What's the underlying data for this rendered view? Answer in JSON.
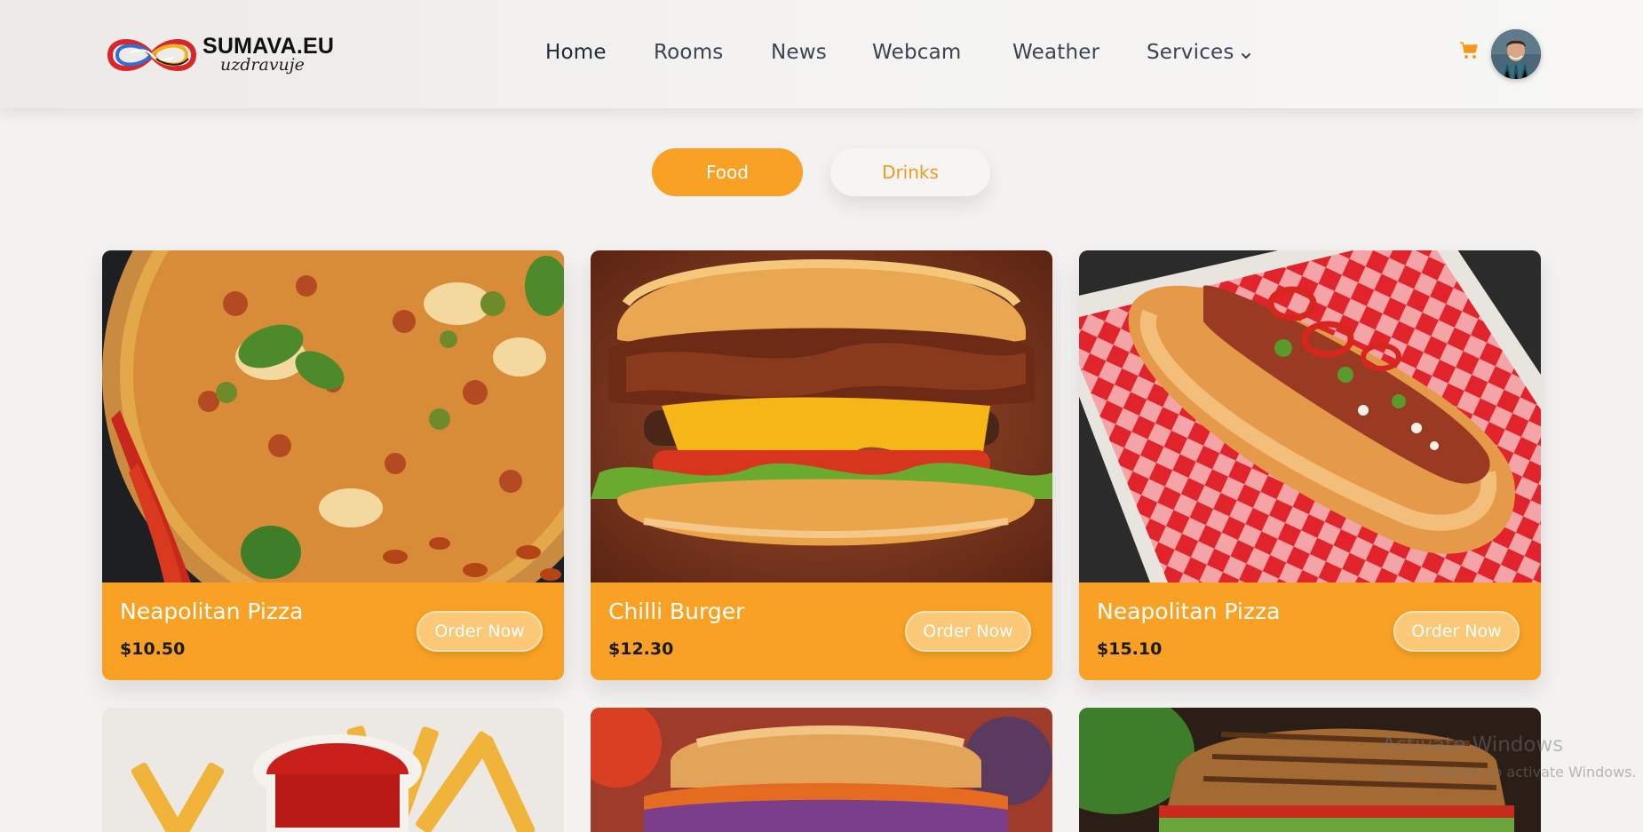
{
  "header": {
    "logo": {
      "brand": "SUMAVA.EU",
      "tagline": "uzdravuje"
    },
    "nav": [
      {
        "label": "Home",
        "active": true
      },
      {
        "label": "Rooms"
      },
      {
        "label": "News"
      },
      {
        "label": "Webcam"
      },
      {
        "label": "Weather"
      },
      {
        "label": "Services",
        "has_dropdown": true
      }
    ],
    "cart_icon": "cart-icon",
    "avatar": "user-avatar"
  },
  "filters": {
    "food": "Food",
    "drinks": "Drinks",
    "active": "Food"
  },
  "cards": [
    {
      "name": "Neapolitan Pizza",
      "price": "$10.50",
      "button": "Order Now",
      "image": "pizza"
    },
    {
      "name": "Chilli Burger",
      "price": "$12.30",
      "button": "Order Now",
      "image": "burger"
    },
    {
      "name": "Neapolitan Pizza",
      "price": "$15.10",
      "button": "Order Now",
      "image": "hotdog"
    }
  ],
  "more_cards": [
    {
      "image": "fries"
    },
    {
      "image": "sandwich"
    },
    {
      "image": "toast-sandwich"
    }
  ],
  "watermark": {
    "title": "Activate Windows",
    "subtitle": "Go to Settings to activate Windows."
  },
  "colors": {
    "accent": "#f8a124",
    "nav_text": "#3a4453",
    "background": "#f3f2f0"
  }
}
